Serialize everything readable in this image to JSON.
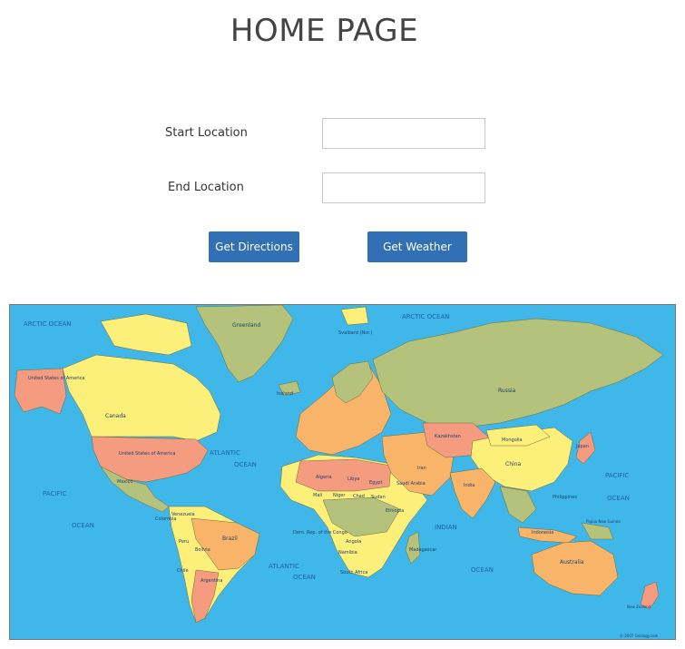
{
  "page": {
    "title": "HOME PAGE"
  },
  "form": {
    "start_label": "Start Location",
    "start_value": "",
    "end_label": "End Location",
    "end_value": "",
    "directions_button": "Get Directions",
    "weather_button": "Get Weather"
  },
  "map": {
    "oceans": {
      "arctic_left": "ARCTIC OCEAN",
      "arctic_right": "ARCTIC OCEAN",
      "atlantic_north_1": "ATLANTIC",
      "atlantic_north_2": "OCEAN",
      "pacific_left_1": "PACIFIC",
      "pacific_left_2": "OCEAN",
      "pacific_right_1": "PACIFIC",
      "pacific_right_2": "OCEAN",
      "atlantic_south_1": "ATLANTIC",
      "atlantic_south_2": "OCEAN",
      "indian": "INDIAN",
      "indian_ocean": "OCEAN"
    },
    "countries": {
      "greenland": "Greenland",
      "canada": "Canada",
      "usa": "United States of America",
      "alaska": "United States of America",
      "mexico": "Mexico",
      "brazil": "Brazil",
      "peru": "Peru",
      "bolivia": "Bolivia",
      "argentina": "Argentina",
      "chile": "Chile",
      "colombia": "Colombia",
      "venezuela": "Venezuela",
      "russia": "Russia",
      "china": "China",
      "mongolia": "Mongolia",
      "kazakhstan": "Kazakhstan",
      "india": "India",
      "iran": "Iran",
      "saudi": "Saudi Arabia",
      "algeria": "Algeria",
      "libya": "Libya",
      "egypt": "Egypt",
      "mali": "Mali",
      "niger": "Niger",
      "chad": "Chad",
      "sudan": "Sudan",
      "ethiopia": "Ethiopia",
      "drc": "Dem. Rep. of the Congo",
      "angola": "Angola",
      "namibia": "Namibia",
      "south_africa": "South Africa",
      "madagascar": "Madagascar",
      "australia": "Australia",
      "indonesia": "Indonesia",
      "japan": "Japan",
      "iceland": "Iceland",
      "svalbard": "Svalbard (Nor.)",
      "new_zealand": "New Zealand",
      "papua": "Papua New Guinea",
      "philippines": "Philippines"
    },
    "copyright": "© 2007 Geology.com"
  },
  "colors": {
    "ocean": "#3fb7e8",
    "button": "#3170b5",
    "land_green": "#b5c27c",
    "land_yellow": "#fdf07a",
    "land_salmon": "#f59b80",
    "land_orange": "#f8b56a"
  }
}
